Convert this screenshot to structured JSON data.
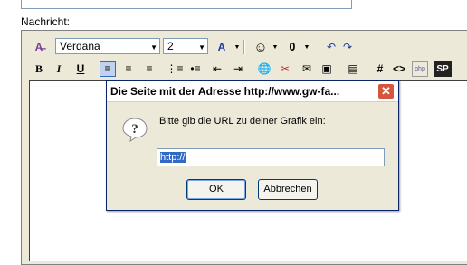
{
  "form": {
    "nachricht_label": "Nachricht:"
  },
  "toolbar": {
    "font_value": "Verdana",
    "size_value": "2",
    "row1": [
      "mode-icon",
      "font-color-icon",
      "smiley-icon",
      "attach-icon",
      "undo-icon",
      "redo-icon"
    ],
    "bold": "B",
    "italic": "I",
    "underline": "U",
    "font_color_letter": "A",
    "hash": "#",
    "code": "<>",
    "php": "php",
    "special": "SP"
  },
  "dialog": {
    "title": "Die Seite mit der Adresse http://www.gw-fa...",
    "close": "✕",
    "prompt": "Bitte gib die URL zu deiner Grafik ein:",
    "url_value": "http://",
    "ok_label": "OK",
    "cancel_label": "Abbrechen"
  },
  "colors": {
    "dialog_bg": "#ece9d8",
    "close_red": "#d7553c",
    "selection": "#316ac5"
  }
}
